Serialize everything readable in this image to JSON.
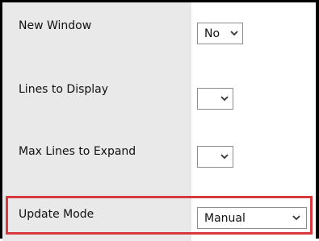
{
  "settings": {
    "rows": [
      {
        "label": "New Window",
        "value": "No"
      },
      {
        "label": "Lines to Display",
        "value": ""
      },
      {
        "label": "Max Lines to Expand",
        "value": ""
      },
      {
        "label": "Update Mode",
        "value": "Manual"
      }
    ]
  },
  "icons": {
    "dropdown": "chevron-down-icon"
  },
  "colors": {
    "label_background": "#e9e9e9",
    "frame_border": "#000000",
    "highlight_border": "#d9393e"
  },
  "highlighted_row": "Update Mode"
}
